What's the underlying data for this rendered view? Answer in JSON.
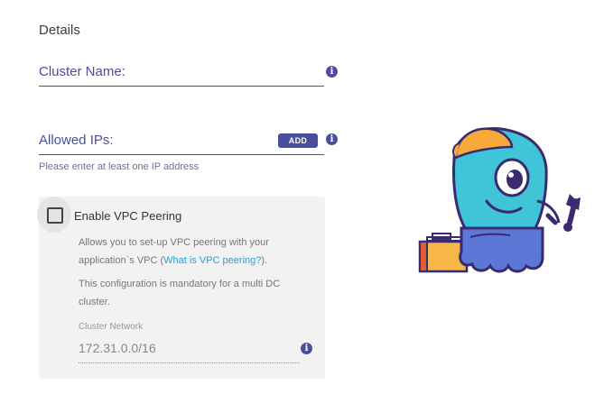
{
  "details": {
    "title": "Details",
    "cluster_name": {
      "label": "Cluster Name:",
      "value": ""
    },
    "allowed_ips": {
      "label": "Allowed IPs:",
      "add_label": "ADD",
      "helper": "Please enter at least one IP address"
    }
  },
  "vpc": {
    "checkbox_label": "Enable VPC Peering",
    "checked": false,
    "desc1_pre": "Allows you to set-up VPC peering with your",
    "desc1_line2": "application`s VPC (",
    "link": "What is VPC peering?",
    "desc1_post": ").",
    "desc2_line1": "This configuration is mandatory for a multi DC",
    "desc2_line2": "cluster.",
    "network_label": "Cluster Network",
    "network_value": "172.31.0.0/16"
  },
  "icons": {
    "info": "info-icon",
    "mascot": "mascot-illustration"
  },
  "colors": {
    "accent": "#4b4f9b",
    "link": "#2a9fd6",
    "panel": "#f2f2f2"
  }
}
